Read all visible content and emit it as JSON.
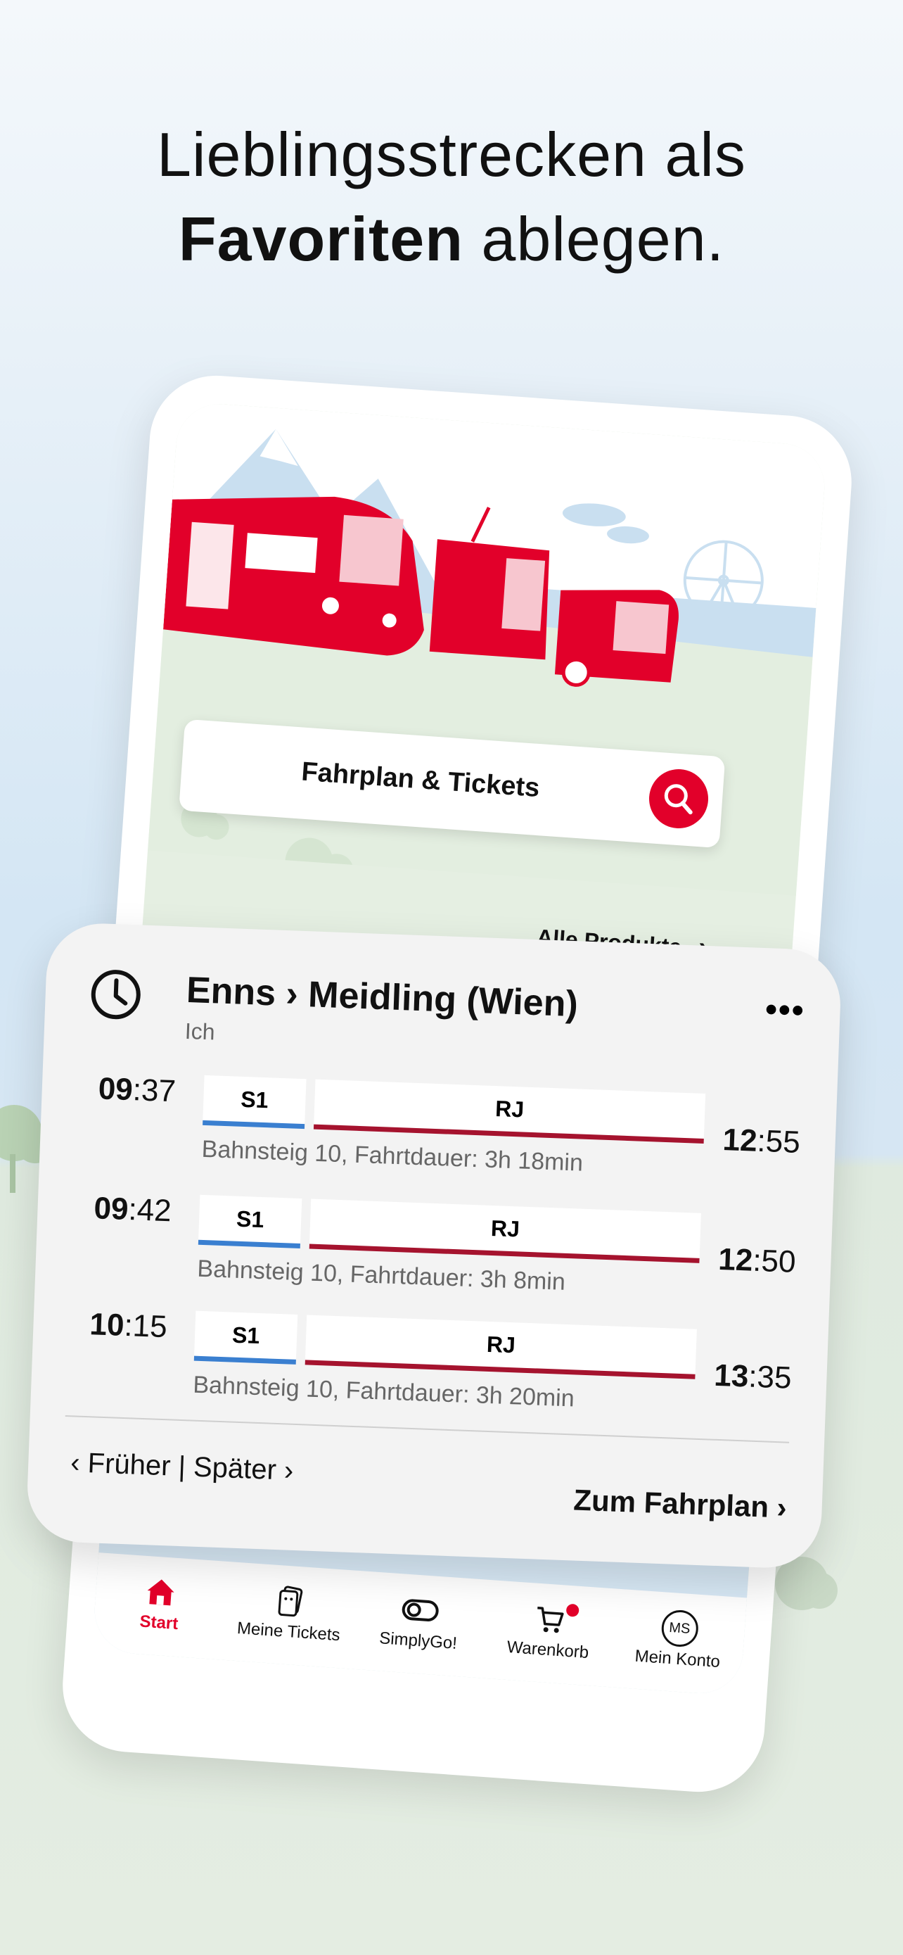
{
  "headline": {
    "line1": "Lieblingsstrecken als",
    "line2_bold": "Favoriten",
    "line2_rest": " ablegen."
  },
  "colors": {
    "brand_red": "#e2002a",
    "s1_blue": "#3a7fd0",
    "rj_red": "#a5132e"
  },
  "app": {
    "search_label": "Fahrplan & Tickets",
    "search_icon": "search-icon",
    "products_link": "Alle Produkte",
    "products_chevron": "›",
    "tabs": [
      {
        "label": "Start",
        "icon": "home-icon",
        "active": true
      },
      {
        "label": "Meine Tickets",
        "icon": "tickets-icon"
      },
      {
        "label": "SimplyGo!",
        "icon": "toggle-icon"
      },
      {
        "label": "Warenkorb",
        "icon": "cart-icon"
      },
      {
        "label": "Mein Konto",
        "icon": "account-icon",
        "avatar_text": "MS"
      }
    ]
  },
  "favorite": {
    "route": "Enns › Meidling (Wien)",
    "owner": "Ich",
    "more": "•••",
    "connections": [
      {
        "dep_h": "09",
        "dep_m": ":37",
        "seg1": "S1",
        "seg2": "RJ",
        "info": "Bahnsteig 10, Fahrtdauer: 3h 18min",
        "arr_h": "12",
        "arr_m": ":55"
      },
      {
        "dep_h": "09",
        "dep_m": ":42",
        "seg1": "S1",
        "seg2": "RJ",
        "info": "Bahnsteig 10, Fahrtdauer: 3h 8min",
        "arr_h": "12",
        "arr_m": ":50"
      },
      {
        "dep_h": "10",
        "dep_m": ":15",
        "seg1": "S1",
        "seg2": "RJ",
        "info": "Bahnsteig 10, Fahrtdauer: 3h 20min",
        "arr_h": "13",
        "arr_m": ":35"
      }
    ],
    "earlier": "‹ Früher",
    "sep": " | ",
    "later": "Später ›",
    "timetable_link": "Zum Fahrplan ›"
  }
}
